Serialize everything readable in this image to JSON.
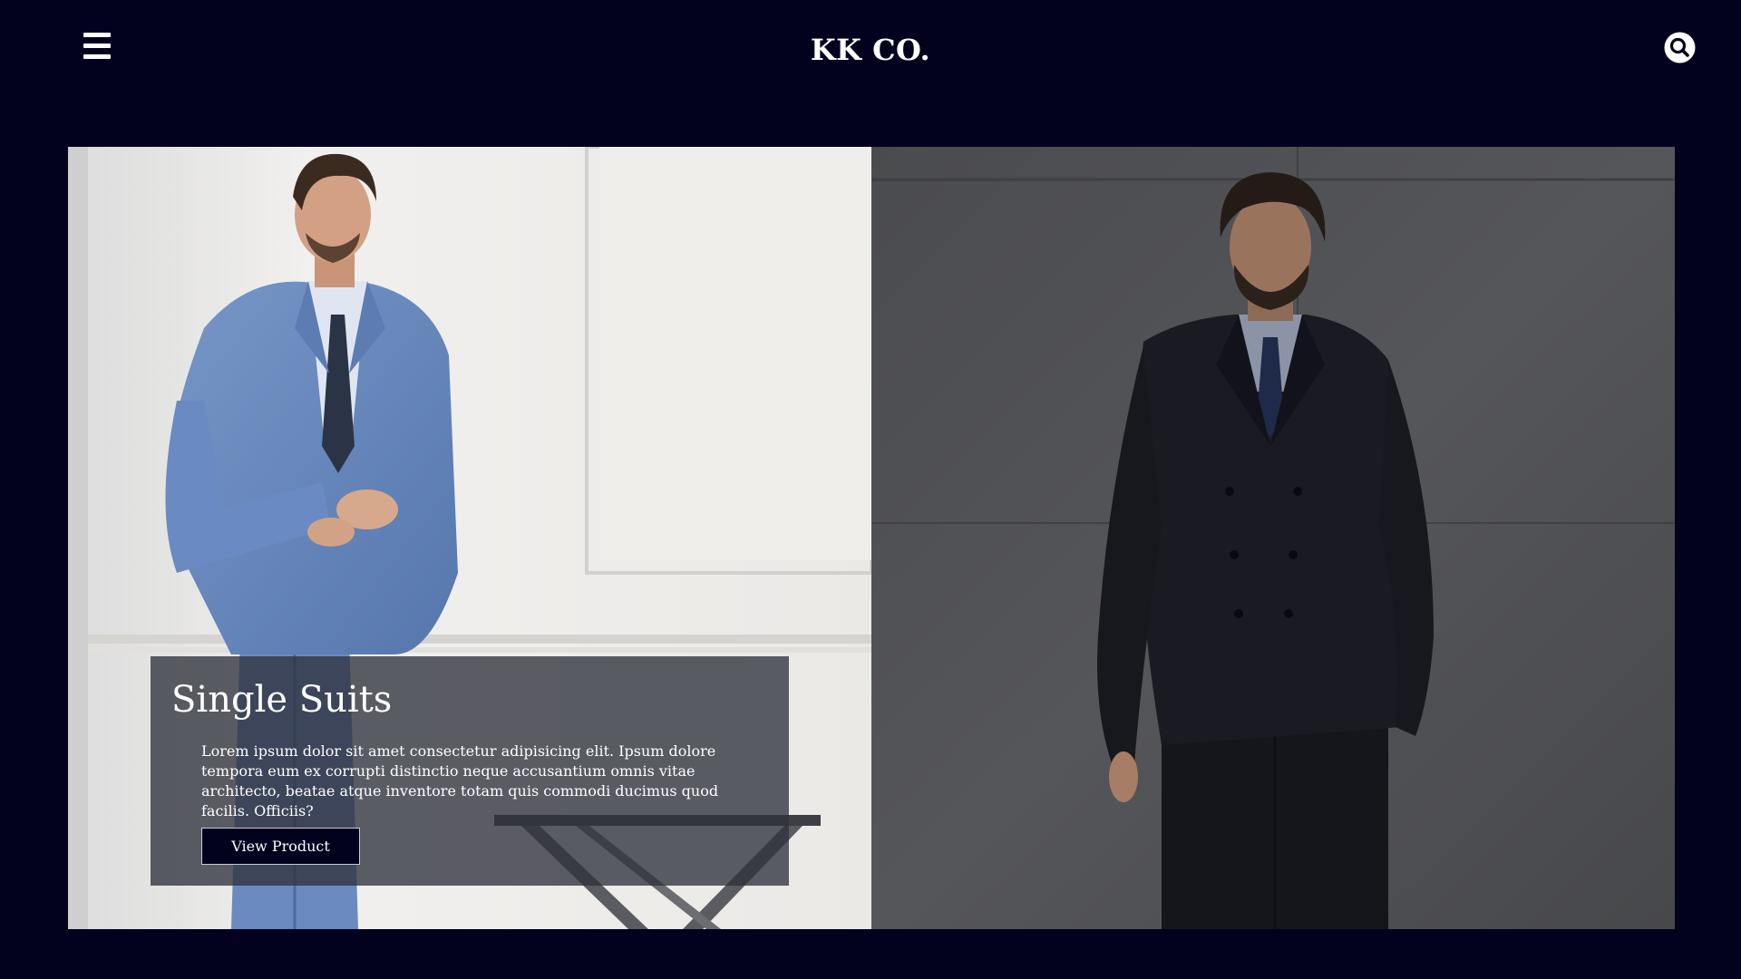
{
  "header": {
    "logo": "KK CO.",
    "menu_icon": "hamburger-menu-icon",
    "search_icon": "search-icon"
  },
  "hero": {
    "left_panel": {
      "image": "man-in-light-blue-suit-photo",
      "card": {
        "title": "Single Suits",
        "description": "Lorem ipsum dolor sit amet consectetur adipisicing elit. Ipsum dolore tempora eum ex corrupti distinctio neque accusantium omnis vitae architecto, beatae atque inventore totam quis commodi ducimus quod facilis. Officiis?",
        "button_label": "View Product"
      }
    },
    "right_panel": {
      "image": "man-in-dark-double-breasted-suit-photo"
    }
  },
  "colors": {
    "background": "#02021f",
    "button_bg": "#02021f",
    "text": "#ffffff",
    "card_overlay": "rgba(48,50,60,0.78)"
  }
}
